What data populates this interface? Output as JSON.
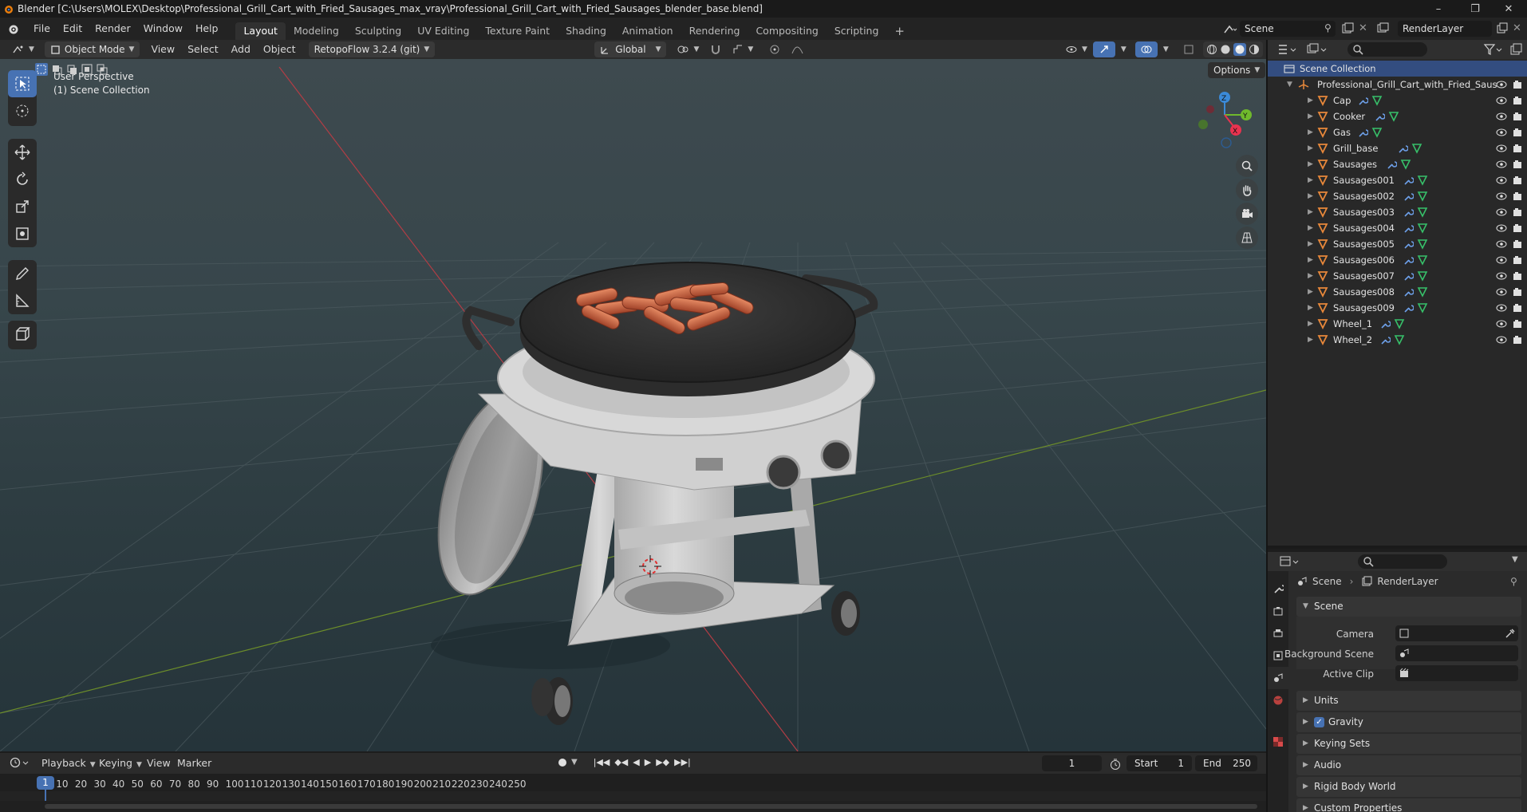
{
  "window": {
    "title": "Blender [C:\\Users\\MOLEX\\Desktop\\Professional_Grill_Cart_with_Fried_Sausages_max_vray\\Professional_Grill_Cart_with_Fried_Sausages_blender_base.blend]"
  },
  "menu": [
    "File",
    "Edit",
    "Render",
    "Window",
    "Help"
  ],
  "workspaces": [
    {
      "label": "Layout",
      "active": true
    },
    {
      "label": "Modeling"
    },
    {
      "label": "Sculpting"
    },
    {
      "label": "UV Editing"
    },
    {
      "label": "Texture Paint"
    },
    {
      "label": "Shading"
    },
    {
      "label": "Animation"
    },
    {
      "label": "Rendering"
    },
    {
      "label": "Compositing"
    },
    {
      "label": "Scripting"
    }
  ],
  "scene_field": "Scene",
  "renderlayer_field": "RenderLayer",
  "viewport_header": {
    "mode": "Object Mode",
    "menus": [
      "View",
      "Select",
      "Add",
      "Object"
    ],
    "addon": "RetopoFlow 3.2.4 (git)",
    "orientation": "Global",
    "options": "Options"
  },
  "viewport": {
    "perspective": "User Perspective",
    "collection": "(1) Scene Collection",
    "gizmo": {
      "z": "Z",
      "y": "Y",
      "x": "X"
    }
  },
  "outliner": {
    "root": "Scene Collection",
    "collection": "Professional_Grill_Cart_with_Fried_Saus",
    "objects": [
      "Cap",
      "Cooker",
      "Gas",
      "Grill_base",
      "Sausages",
      "Sausages001",
      "Sausages002",
      "Sausages003",
      "Sausages004",
      "Sausages005",
      "Sausages006",
      "Sausages007",
      "Sausages008",
      "Sausages009",
      "Wheel_1",
      "Wheel_2"
    ]
  },
  "properties": {
    "breadcrumb": {
      "scene": "Scene",
      "layer": "RenderLayer"
    },
    "scene_panel": "Scene",
    "fields": {
      "camera": "Camera",
      "background": "Background Scene",
      "clip": "Active Clip"
    },
    "panels": [
      "Units",
      "Gravity",
      "Keying Sets",
      "Audio",
      "Rigid Body World",
      "Custom Properties"
    ]
  },
  "timeline": {
    "menus": [
      "Playback",
      "Keying",
      "View",
      "Marker"
    ],
    "current_frame": "1",
    "start_label": "Start",
    "start": "1",
    "end_label": "End",
    "end": "250",
    "ticks": [
      "1",
      "10",
      "20",
      "30",
      "40",
      "50",
      "60",
      "70",
      "80",
      "90",
      "100",
      "110",
      "120",
      "130",
      "140",
      "150",
      "160",
      "170",
      "180",
      "190",
      "200",
      "210",
      "220",
      "230",
      "240",
      "250"
    ]
  },
  "colors": {
    "accent": "#4772b3",
    "object_icon": "#e8883a",
    "x_axis": "#e8334f",
    "y_axis": "#6fb92c",
    "z_axis": "#3b8ad8"
  }
}
